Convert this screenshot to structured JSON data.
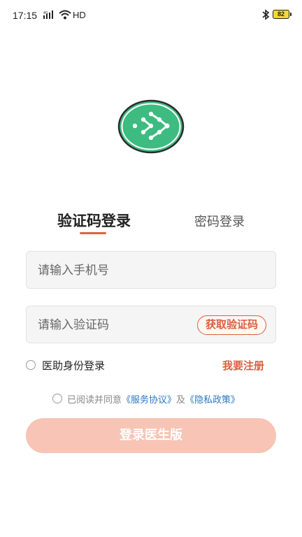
{
  "status_bar": {
    "time": "17:15",
    "network": "HD",
    "battery": "82"
  },
  "tabs": {
    "sms_login": "验证码登录",
    "password_login": "密码登录"
  },
  "form": {
    "phone_placeholder": "请输入手机号",
    "code_placeholder": "请输入验证码",
    "get_code": "获取验证码"
  },
  "options": {
    "doctor_assist_login": "医助身份登录",
    "register": "我要注册"
  },
  "agreement": {
    "prefix": "已阅读并同意",
    "service_link": "《服务协议》",
    "and": "及",
    "privacy_link": "《隐私政策》"
  },
  "login_button": "登录医生版",
  "colors": {
    "accent": "#d9603e",
    "logo_green": "#3dbb80",
    "login_button_disabled": "#f7c4b6",
    "link": "#2a78c6"
  }
}
